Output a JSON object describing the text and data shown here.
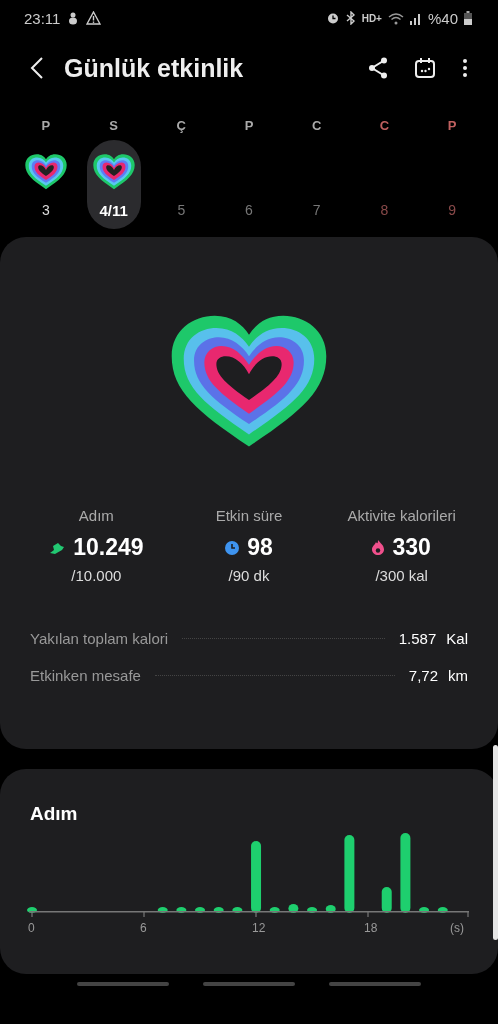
{
  "status_bar": {
    "time": "23:11",
    "network": "HD+",
    "battery": "%40"
  },
  "header": {
    "title": "Günlük etkinlik"
  },
  "days": [
    {
      "weekday": "P",
      "date": "3",
      "selected": false,
      "weekend": false,
      "future": false,
      "has_ring": true
    },
    {
      "weekday": "S",
      "date": "4/11",
      "selected": true,
      "weekend": false,
      "future": false,
      "has_ring": true
    },
    {
      "weekday": "Ç",
      "date": "5",
      "selected": false,
      "weekend": false,
      "future": true,
      "has_ring": false
    },
    {
      "weekday": "P",
      "date": "6",
      "selected": false,
      "weekend": false,
      "future": true,
      "has_ring": false
    },
    {
      "weekday": "C",
      "date": "7",
      "selected": false,
      "weekend": false,
      "future": true,
      "has_ring": false
    },
    {
      "weekday": "C",
      "date": "8",
      "selected": false,
      "weekend": true,
      "future": true,
      "has_ring": false
    },
    {
      "weekday": "P",
      "date": "9",
      "selected": false,
      "weekend": true,
      "future": true,
      "has_ring": false
    }
  ],
  "stats": [
    {
      "kind": "steps",
      "label": "Adım",
      "value": "10.249",
      "goal": "/10.000"
    },
    {
      "kind": "time",
      "label": "Etkin süre",
      "value": "98",
      "goal": "/90 dk"
    },
    {
      "kind": "calories",
      "label": "Aktivite kalorileri",
      "value": "330",
      "goal": "/300 kal"
    }
  ],
  "details": [
    {
      "label": "Yakılan toplam kalori",
      "value": "1.587",
      "unit": "Kal"
    },
    {
      "label": "Etkinken mesafe",
      "value": "7,72",
      "unit": "km"
    }
  ],
  "steps_chart": {
    "title": "Adım",
    "axis_labels": [
      "0",
      "6",
      "12",
      "18",
      "(s)"
    ]
  }
}
